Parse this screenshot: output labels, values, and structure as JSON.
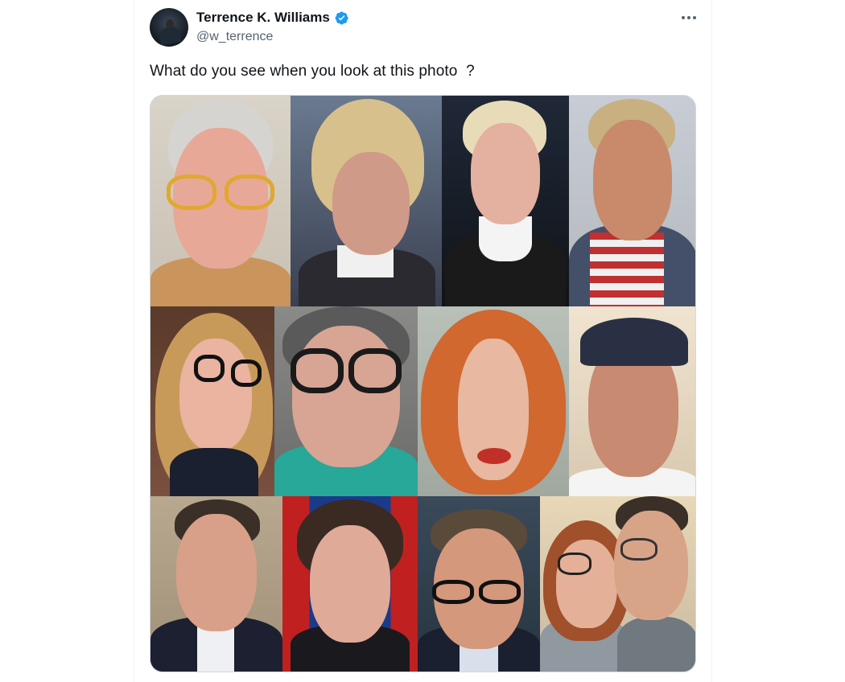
{
  "author": {
    "name": "Terrence K. Williams",
    "handle": "@w_terrence",
    "verified": true,
    "avatar_icon": "profile-avatar"
  },
  "tweet": {
    "text": "What do you see when you look at this photo  ?"
  },
  "media": {
    "grid_rows": 3,
    "grid_cols": 4
  },
  "colors": {
    "verified_blue": "#1d9bf0",
    "text_primary": "#0f1419",
    "text_secondary": "#536471",
    "border": "#cfd9de"
  }
}
